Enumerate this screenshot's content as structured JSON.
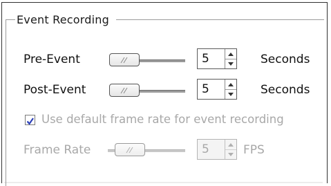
{
  "group": {
    "title": "Event Recording"
  },
  "pre_event": {
    "label": "Pre-Event",
    "value": "5",
    "unit": "Seconds",
    "slider_level": 0.0
  },
  "post_event": {
    "label": "Post-Event",
    "value": "5",
    "unit": "Seconds",
    "slider_level": 0.0
  },
  "default_rate": {
    "label": "Use default frame rate for event recording",
    "checked": true
  },
  "frame_rate": {
    "label": "Frame Rate",
    "value": "5",
    "unit": "FPS",
    "slider_level": 0.0,
    "disabled": true
  },
  "colors": {
    "check_mark": "#2b3fb8",
    "disabled_text": "#a8a8a8"
  }
}
